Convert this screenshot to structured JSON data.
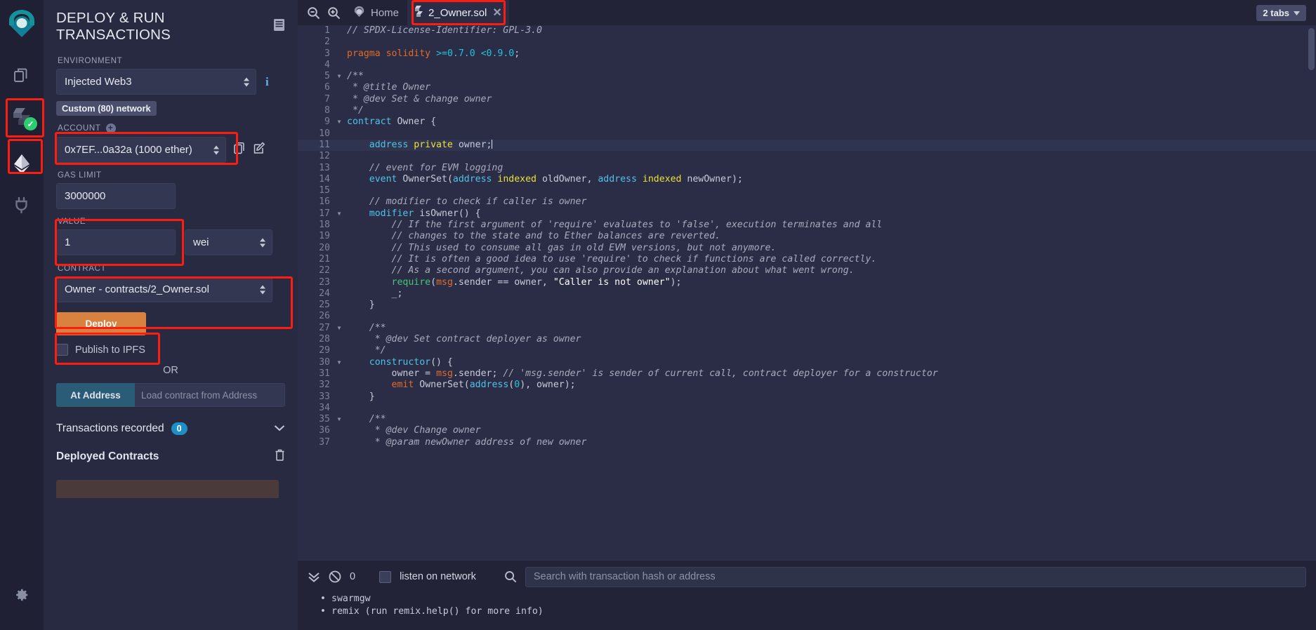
{
  "rail": {
    "logo": "remix-logo",
    "items": [
      {
        "name": "file-explorers-icon",
        "label": "File explorers"
      },
      {
        "name": "solidity-compiler-icon",
        "label": "Solidity compiler",
        "badge": "check"
      },
      {
        "name": "deploy-run-transactions-icon",
        "label": "Deploy & run transactions"
      },
      {
        "name": "plugin-manager-icon",
        "label": "Plugin manager"
      }
    ],
    "settings": {
      "name": "settings-gear-icon",
      "label": "Settings"
    }
  },
  "panel": {
    "title": "DEPLOY & RUN TRANSACTIONS",
    "environment": {
      "label": "ENVIRONMENT",
      "value": "Injected Web3",
      "network_badge": "Custom (80) network"
    },
    "account": {
      "label": "ACCOUNT",
      "value": "0x7EF...0a32a (1000 ether)",
      "copy_icon": "copy-icon",
      "edit_icon": "edit-icon",
      "add_icon": "plus-icon"
    },
    "gas_limit": {
      "label": "GAS LIMIT",
      "value": "3000000"
    },
    "value": {
      "label": "VALUE",
      "value": "1",
      "unit": "wei"
    },
    "contract": {
      "label": "CONTRACT",
      "value": "Owner - contracts/2_Owner.sol"
    },
    "deploy_label": "Deploy",
    "publish_ipfs_label": "Publish to IPFS",
    "or_label": "OR",
    "at_address_label": "At Address",
    "at_address_placeholder": "Load contract from Address",
    "transactions_recorded_label": "Transactions recorded",
    "transactions_recorded_count": "0",
    "deployed_contracts_label": "Deployed Contracts"
  },
  "editor": {
    "zoom_out_icon": "zoom-out-icon",
    "zoom_in_icon": "zoom-in-icon",
    "home_icon": "remix-home-icon",
    "home_label": "Home",
    "file_tab": {
      "label": "2_Owner.sol",
      "file_icon": "solidity-file-icon",
      "close_icon": "close-icon"
    },
    "tabs_count_label": "2 tabs"
  },
  "code": [
    {
      "n": 1,
      "fold": false,
      "html": "<span class='c-comment'>// SPDX-License-Identifier: GPL-3.0</span>"
    },
    {
      "n": 2,
      "fold": false,
      "html": ""
    },
    {
      "n": 3,
      "fold": false,
      "html": "<span class='c-kw'>pragma</span> <span class='c-kw'>solidity</span> <span class='c-num'>&gt;=0.7.0 &lt;0.9.0</span><span class='c-plain'>;</span>"
    },
    {
      "n": 4,
      "fold": false,
      "html": ""
    },
    {
      "n": 5,
      "fold": true,
      "html": "<span class='c-comment'>/**</span>"
    },
    {
      "n": 6,
      "fold": false,
      "html": "<span class='c-comment'> * @title Owner</span>"
    },
    {
      "n": 7,
      "fold": false,
      "html": "<span class='c-comment'> * @dev Set &amp; change owner</span>"
    },
    {
      "n": 8,
      "fold": false,
      "html": "<span class='c-comment'> */</span>"
    },
    {
      "n": 9,
      "fold": true,
      "html": "<span class='c-type'>contract</span> <span class='c-plain'>Owner {</span>"
    },
    {
      "n": 10,
      "fold": false,
      "html": ""
    },
    {
      "n": 11,
      "fold": false,
      "active": true,
      "html": "    <span class='c-type'>address</span> <span class='c-yellow'>private</span> <span class='c-plain'>owner;</span><span class='cursor'></span>"
    },
    {
      "n": 12,
      "fold": false,
      "html": ""
    },
    {
      "n": 13,
      "fold": false,
      "html": "    <span class='c-comment'>// event for EVM logging</span>"
    },
    {
      "n": 14,
      "fold": false,
      "html": "    <span class='c-type'>event</span> <span class='c-plain'>OwnerSet(</span><span class='c-type'>address</span> <span class='c-yellow'>indexed</span> <span class='c-plain'>oldOwner, </span><span class='c-type'>address</span> <span class='c-yellow'>indexed</span> <span class='c-plain'>newOwner);</span>"
    },
    {
      "n": 15,
      "fold": false,
      "html": ""
    },
    {
      "n": 16,
      "fold": false,
      "html": "    <span class='c-comment'>// modifier to check if caller is owner</span>"
    },
    {
      "n": 17,
      "fold": true,
      "html": "    <span class='c-type'>modifier</span> <span class='c-plain'>isOwner() {</span>"
    },
    {
      "n": 18,
      "fold": false,
      "html": "        <span class='c-comment'>// If the first argument of 'require' evaluates to 'false', execution terminates and all</span>"
    },
    {
      "n": 19,
      "fold": false,
      "html": "        <span class='c-comment'>// changes to the state and to Ether balances are reverted.</span>"
    },
    {
      "n": 20,
      "fold": false,
      "html": "        <span class='c-comment'>// This used to consume all gas in old EVM versions, but not anymore.</span>"
    },
    {
      "n": 21,
      "fold": false,
      "html": "        <span class='c-comment'>// It is often a good idea to use 'require' to check if functions are called correctly.</span>"
    },
    {
      "n": 22,
      "fold": false,
      "html": "        <span class='c-comment'>// As a second argument, you can also provide an explanation about what went wrong.</span>"
    },
    {
      "n": 23,
      "fold": false,
      "html": "        <span class='c-green'>require</span><span class='c-plain'>(</span><span class='c-orange2'>msg</span><span class='c-plain'>.sender == owner, </span><span class='c-str'>\"Caller is not owner\"</span><span class='c-plain'>);</span>"
    },
    {
      "n": 24,
      "fold": false,
      "html": "        <span class='c-plain'>_;</span>"
    },
    {
      "n": 25,
      "fold": false,
      "html": "    <span class='c-plain'>}</span>"
    },
    {
      "n": 26,
      "fold": false,
      "html": ""
    },
    {
      "n": 27,
      "fold": true,
      "html": "    <span class='c-comment'>/**</span>"
    },
    {
      "n": 28,
      "fold": false,
      "html": "     <span class='c-comment'>* @dev Set contract deployer as owner</span>"
    },
    {
      "n": 29,
      "fold": false,
      "html": "     <span class='c-comment'>*/</span>"
    },
    {
      "n": 30,
      "fold": true,
      "html": "    <span class='c-fn'>constructor</span><span class='c-plain'>() {</span>"
    },
    {
      "n": 31,
      "fold": false,
      "html": "        <span class='c-plain'>owner = </span><span class='c-orange2'>msg</span><span class='c-plain'>.sender; </span><span class='c-comment'>// 'msg.sender' is sender of current call, contract deployer for a constructor</span>"
    },
    {
      "n": 32,
      "fold": false,
      "html": "        <span class='c-kw'>emit</span> <span class='c-plain'>OwnerSet(</span><span class='c-type'>address</span><span class='c-plain'>(</span><span class='c-num'>0</span><span class='c-plain'>), owner);</span>"
    },
    {
      "n": 33,
      "fold": false,
      "html": "    <span class='c-plain'>}</span>"
    },
    {
      "n": 34,
      "fold": false,
      "html": ""
    },
    {
      "n": 35,
      "fold": true,
      "html": "    <span class='c-comment'>/**</span>"
    },
    {
      "n": 36,
      "fold": false,
      "html": "     <span class='c-comment'>* @dev Change owner</span>"
    },
    {
      "n": 37,
      "fold": false,
      "html": "     <span class='c-comment'>* @param newOwner address of new owner</span>"
    }
  ],
  "terminal": {
    "toggle_icon": "chevrons-down-icon",
    "clear_icon": "no-entry-icon",
    "pending_count": "0",
    "listen_label": "listen on network",
    "search_icon": "search-icon",
    "search_placeholder": "Search with transaction hash or address",
    "console_lines": [
      "swarmgw",
      "remix (run remix.help() for more info)"
    ]
  }
}
